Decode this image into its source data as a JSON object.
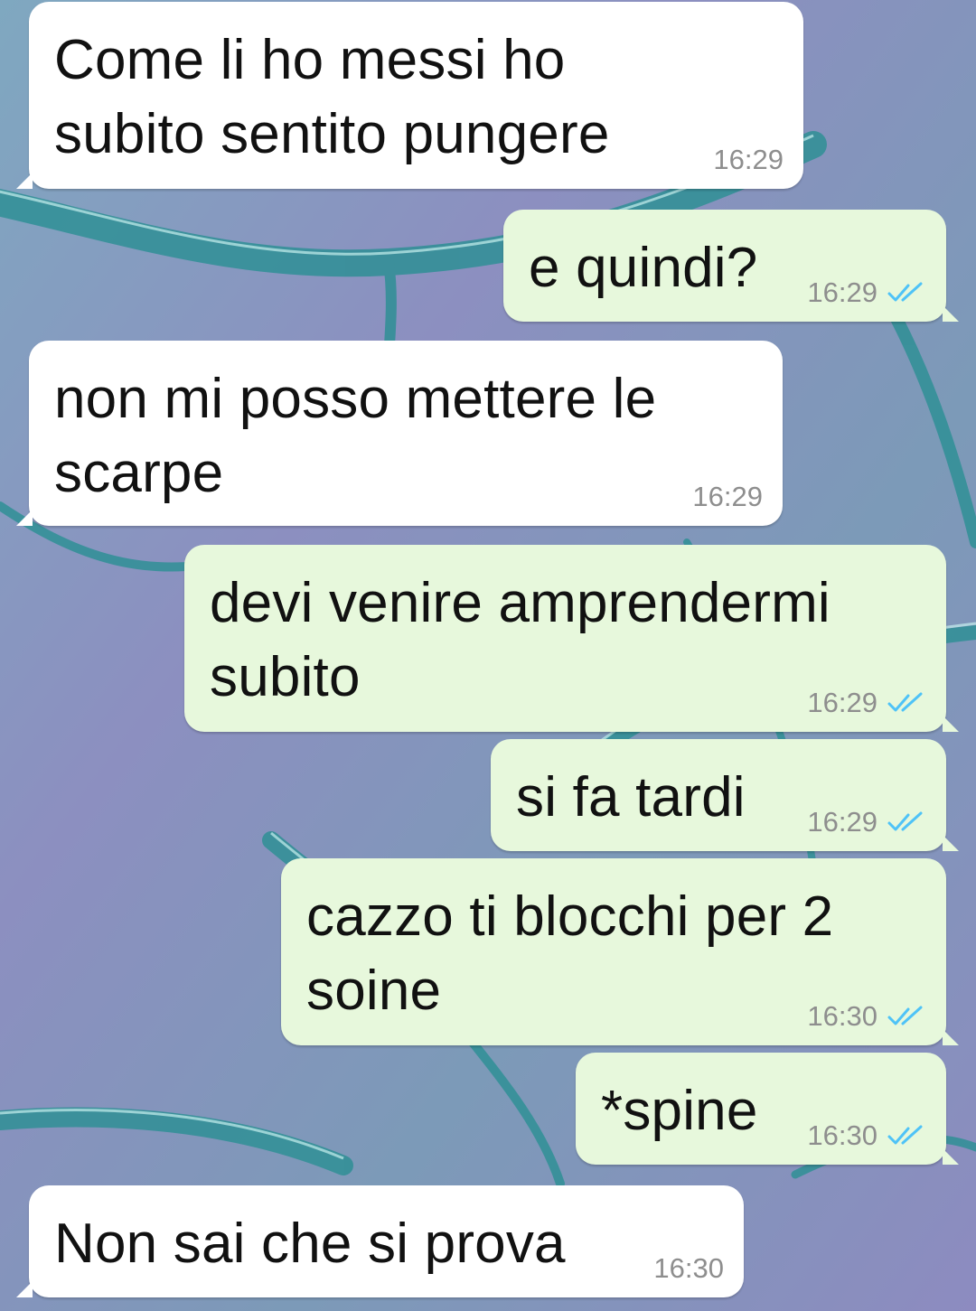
{
  "theme": {
    "incoming_bubble": "#ffffff",
    "outgoing_bubble": "#e7f8dc",
    "read_tick_color": "#4fc3f7",
    "wallpaper_base": "#8f8fb8",
    "wallpaper_glass": "#3aa6a6"
  },
  "messages": [
    {
      "direction": "in",
      "text": "Come li ho messi ho\nsubito sentito pungere",
      "time": "16:29",
      "status": ""
    },
    {
      "direction": "out",
      "text": "e quindi?",
      "time": "16:29",
      "status": "read-double-check-icon"
    },
    {
      "direction": "in",
      "text": "non mi posso mettere le\nscarpe",
      "time": "16:29",
      "status": ""
    },
    {
      "direction": "out",
      "text": "devi venire amprendermi\nsubito",
      "time": "16:29",
      "status": "read-double-check-icon"
    },
    {
      "direction": "out",
      "text": "si fa tardi",
      "time": "16:29",
      "status": "read-double-check-icon"
    },
    {
      "direction": "out",
      "text": "cazzo ti blocchi per 2\nsoine",
      "time": "16:30",
      "status": "read-double-check-icon"
    },
    {
      "direction": "out",
      "text": "*spine",
      "time": "16:30",
      "status": "read-double-check-icon"
    },
    {
      "direction": "in",
      "text": "Non sai che si prova",
      "time": "16:30",
      "status": ""
    }
  ]
}
